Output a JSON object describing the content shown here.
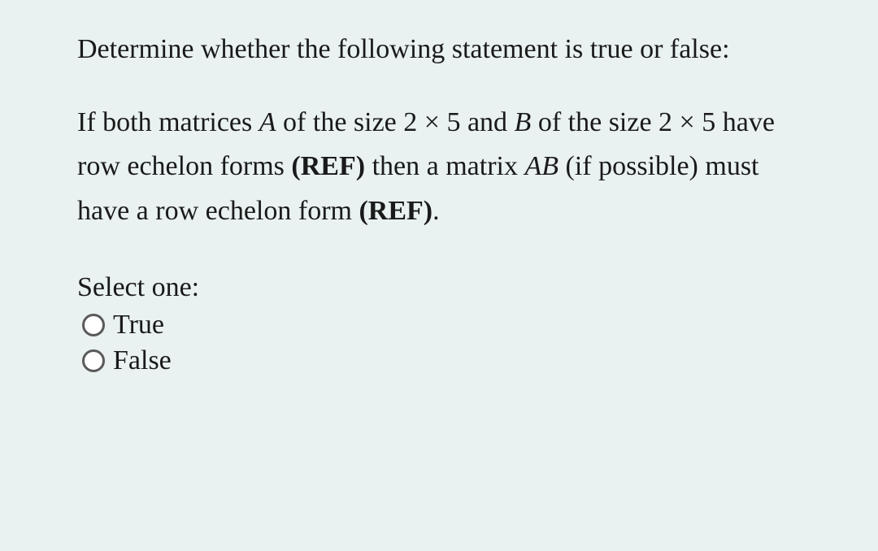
{
  "question": {
    "prompt": "Determine whether the following statement is true or false:",
    "body_parts": {
      "p1": "If both matrices ",
      "varA": "A",
      "p2": " of the size ",
      "sizeA": "2 × 5",
      "p3": " and ",
      "varB": "B",
      "p4": " of the size ",
      "sizeB": "2 × 5",
      "p5": " have row echelon forms ",
      "ref1": "(REF)",
      "p6": " then a matrix ",
      "varAB": "AB",
      "p7": " (if possible) must have a row echelon form ",
      "ref2": "(REF)",
      "p8": "."
    }
  },
  "select": {
    "label": "Select one:",
    "options": {
      "true": "True",
      "false": "False"
    }
  }
}
